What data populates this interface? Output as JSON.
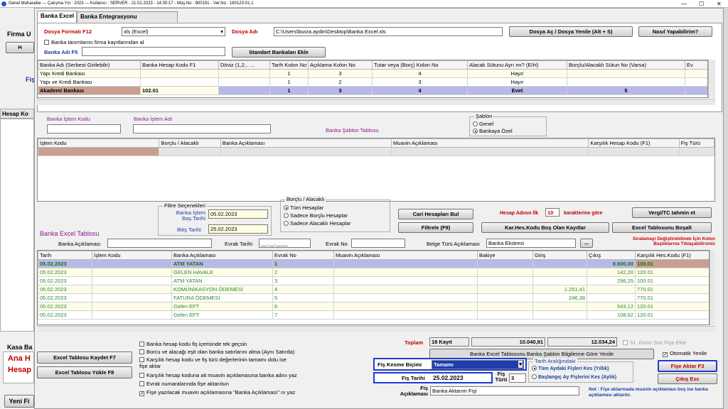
{
  "window": {
    "title": "Genel Muhasebe  ---  Çalışma Yılı : 2023  ---  Kullanıcı : SERVER - 21.02.2023 - 14:35:17 - Müş.No : 800191 - Ver.No : 180123-01.1",
    "minimize": "—",
    "maximize": "☐",
    "close": "✕"
  },
  "bg_left": {
    "firma_label": "Firma U",
    "btn1": "H",
    "fis": "Fiş",
    "hesap_ko": "Hesap Ko",
    "kasa_ba": "Kasa Ba",
    "ana_h": "Ana H",
    "hesap": "Hesap",
    "yeni_fi": "Yeni Fi"
  },
  "tabs": [
    "Banka Excel",
    "Banka Entegrasyonu"
  ],
  "top": {
    "format_label": "Dosya Formatı F12",
    "format_value": "xls (Excel)",
    "dosya_label": "Dosya Adı",
    "dosya_value": "C:\\Users\\busra.aydin\\Desktop\\Banka Excel.xls",
    "open_btn": "Dosya Aç / Dosya Yenile (Alt + S)",
    "how_btn": "Nasıl Yapabilirim?",
    "check_label": "Banka tanımlarını firma kayıtlarından al",
    "banka_adi_label": "Banka Adı F5",
    "std_btn": "Standart Bankaları Ekle"
  },
  "bank_table": {
    "headers": [
      "Banka Adı (Serbest Girilebilir)",
      "Banka Hesap Kodu F1",
      "Döviz (1,2,.. ...",
      "Tarih Kolon No",
      "Açıklama Kolon No",
      "Tutar veya (Borç) Kolon No",
      "Alacak Sütunu Ayrı mı? (E/H)",
      "Borçlu/Alacaklı Sütun No (Varsa)",
      "Ev"
    ],
    "rows": [
      [
        "Yapı Kredi Bankası",
        "",
        "",
        "1",
        "3",
        "4",
        "Hayır",
        "",
        ""
      ],
      [
        "Yapı ve Kredi Bankası",
        "",
        "",
        "1",
        "2",
        "3",
        "Hayır",
        "",
        ""
      ],
      [
        "Akademi Bankası",
        "102.01",
        "",
        "1",
        "3",
        "4",
        "Evet",
        "5",
        ""
      ]
    ]
  },
  "islem": {
    "kodu_label": "Banka İşlem Kodu",
    "adi_label": "Banka İşlem Adı",
    "sablon_tablosu": "Banka Şablon Tablosu",
    "sablon_title": "Şablon",
    "genel": "Genel",
    "bankaya_ozel": "Bankaya Özel"
  },
  "sablon_table": {
    "headers": [
      "İşlem Kodu",
      "Borçlu / Alacaklı",
      "Banka Açıklaması",
      "Muavin Açıklaması",
      "Karşılık Hesap Kodu (F1)",
      "Fiş Türü"
    ]
  },
  "filter": {
    "title": "Filtre Seçenekleri",
    "bas_label": "Banka İşlem Baş.Tarihi",
    "bas_value": "05.02.2023",
    "bit_label": "Bitiş Tarihi",
    "bit_value": "25.02.2023",
    "ba_title": "Borçlu / Alacaklı",
    "opt_all": "Tüm Hesaplar",
    "opt_borc": "Sadece Borçlu Hesaplar",
    "opt_alacak": "Sadece Alacaklı Hesaplar"
  },
  "actions": {
    "cari_btn": "Cari Hesapları Bul",
    "hesap_adinin": "Hesap Adının İlk",
    "ilk_value": "10",
    "karakter": "karakterine göre",
    "vergi_btn": "Vergi/TC tahmin et",
    "filtrele_btn": "Filtrele (F9)",
    "kar_btn": "Kar.Hes.Kodu Boş Olan Kayıtlar",
    "bosalt_btn": "Excel Tablosunu Boşalt"
  },
  "excel": {
    "title": "Banka Excel Tablosu",
    "aciklamasi_label": "Banka Açıklaması",
    "evrak_tarihi_label": "Evrak Tarihi",
    "evrak_tarihi_value": "__.__.____",
    "evrak_no_label": "Evrak No",
    "belge_label": "Belge Türü Açıklaması",
    "belge_value": "Banka Ekstresi",
    "more_btn": "...",
    "siralama_note": "Sıralamayı Değiştirebilmek İçin Kolon Başlıklarına Tıklayabilirsiniz",
    "headers": [
      "Tarih",
      "İşlem Kodu",
      "Banka Açıklaması",
      "Evrak No",
      "Muavin Açıklaması",
      "Bakiye",
      "Giriş",
      "Çıkış",
      "Karşılık Hes.Kodu (F1)"
    ],
    "rows": [
      [
        "05.02.2023",
        "",
        "ATM YATAN",
        "1",
        "",
        "",
        "",
        "8.500,00",
        "100.01"
      ],
      [
        "05.02.2023",
        "",
        "GELEN HAVALE",
        "2",
        "",
        "",
        "",
        "142,20",
        "120.01"
      ],
      [
        "05.02.2023",
        "",
        "ATM YATAN",
        "3",
        "",
        "",
        "",
        "296,25",
        "100.01"
      ],
      [
        "05.02.2023",
        "",
        "KOMÜNİKASYON ÖDEMESİ",
        "4",
        "",
        "",
        "1.251,41",
        "",
        "770.01"
      ],
      [
        "05.02.2023",
        "",
        "FATURA ÖDEMESİ",
        "5",
        "",
        "",
        "246,38",
        "",
        "770.01"
      ],
      [
        "05.02.2023",
        "",
        "Gelen EFT",
        "6",
        "",
        "",
        "",
        "543,12",
        "120.01"
      ],
      [
        "05.02.2023",
        "",
        "Gelen EFT",
        "7",
        "",
        "",
        "",
        "108,62",
        "120.01"
      ]
    ]
  },
  "totals": {
    "toplam_label": "Toplam",
    "kayit": "18 Kayıt",
    "giris_total": "10.040,91",
    "cikis_total": "12.034,24",
    "son_fis": "31. Günü Son Fişe Ekle",
    "guncelle_btn": "Banka Excel Tablosunu Banka Şablon Bilgilerine Göre Yenile",
    "oto_yenile": "Otomatik Yenile"
  },
  "bottom": {
    "save_btn": "Excel Tablosu Kaydet F7",
    "load_btn": "Excel Tablosu Yükle F8",
    "checks": [
      {
        "label": "Banka hesap kodu fiş içerisinde tek geçsin",
        "checked": false
      },
      {
        "label": "Borcu ve alacağı eşit olan banka satırlarını alma (Aynı Satırda)",
        "checked": false
      },
      {
        "label": "Karşılık hesap kodu ve fiş türü değerlerinin tamamı dolu ise fişe aktar",
        "checked": false
      },
      {
        "label": "Karşılık hesap koduna ait muavin açıklamasına banka adını yaz",
        "checked": false
      },
      {
        "label": "Evrak numaralarında fişe aktarılsın",
        "checked": false
      },
      {
        "label": "Fişe yazılacak muavin açıklamasına \"Banka Açıklaması\" nı yaz",
        "checked": true
      }
    ],
    "kesme_label": "Fiş Kesme Biçimi",
    "kesme_value": "Tamamı",
    "fis_tarihi_label": "Fiş Tarihi",
    "fis_tarihi_value": "25.02.2023",
    "fis_turu_label": "Fiş Türü",
    "fis_turu_value": "3",
    "fis_aciklama_label": "Fiş Açıklaması",
    "fis_aciklama_value": "Banka Aktarım Fişi",
    "tarih_araligi": "Tarih Aralığındaki",
    "tum_aydaki": "Tüm Aydaki Fişleri Kes (Yıllık)",
    "baslangic": "Başlangıç Ay Fişlerini Kes (Aylık)",
    "aktar_btn": "Fişe Aktar F3",
    "cikis_btn": "Çıkış Esc",
    "note": "Not : Fişe aktarmada muavin açıklaması boş ise banka açıklaması aktarılır."
  }
}
